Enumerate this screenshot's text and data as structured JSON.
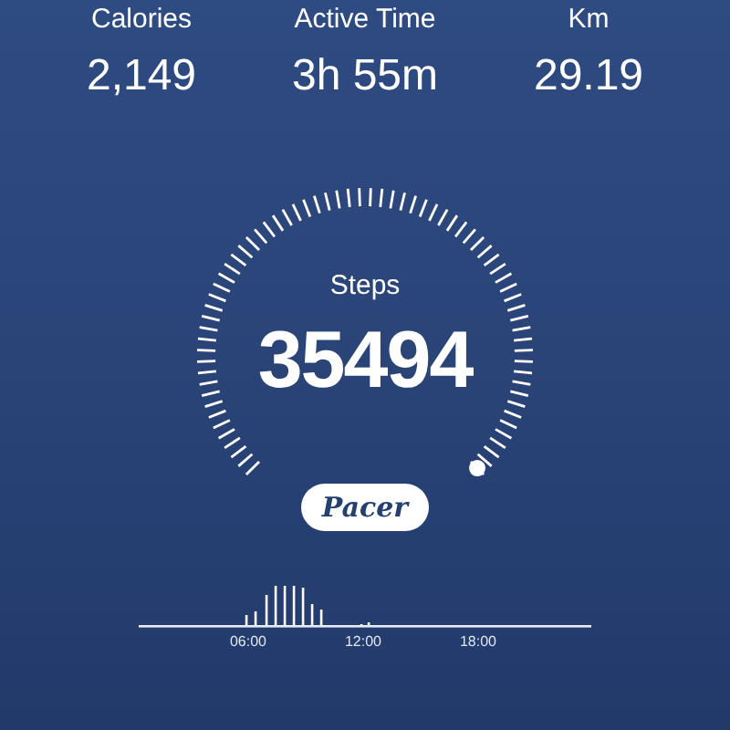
{
  "stats": [
    {
      "label": "Calories",
      "value": "2,149"
    },
    {
      "label": "Active Time",
      "value": "3h 55m"
    },
    {
      "label": "Km",
      "value": "29.19"
    }
  ],
  "gauge": {
    "label": "Steps",
    "value": "35494"
  },
  "brand": {
    "label": "Pacer"
  },
  "activity_chart": {
    "axis_labels": [
      "06:00",
      "12:00",
      "18:00"
    ]
  }
}
